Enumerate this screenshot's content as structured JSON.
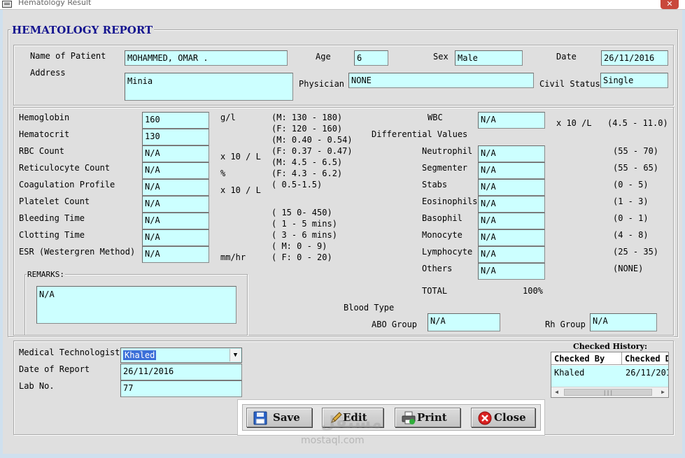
{
  "window": {
    "title": "Hematology Result"
  },
  "report_title": "HEMATOLOGY REPORT",
  "patient": {
    "name_label": "Name of Patient",
    "name": "MOHAMMED, OMAR  .",
    "age_label": "Age",
    "age": "6",
    "sex_label": "Sex",
    "sex": "Male",
    "date_label": "Date",
    "date": "26/11/2016",
    "address_label": "Address",
    "address": "Minia",
    "physician_label": "Physician",
    "physician": "NONE",
    "civil_status_label": "Civil Status",
    "civil_status": "Single"
  },
  "tests": [
    {
      "label": "Hemoglobin",
      "value": "160"
    },
    {
      "label": "Hematocrit",
      "value": "130"
    },
    {
      "label": "RBC Count",
      "value": "N/A"
    },
    {
      "label": "Reticulocyte Count",
      "value": "N/A"
    },
    {
      "label": "Coagulation Profile",
      "value": "N/A"
    },
    {
      "label": "Platelet Count",
      "value": "N/A"
    },
    {
      "label": "Bleeding Time",
      "value": "N/A"
    },
    {
      "label": "Clotting Time",
      "value": "N/A"
    },
    {
      "label": "ESR (Westergren Method)",
      "value": "N/A"
    }
  ],
  "units": {
    "hemoglobin": "g/l",
    "rbc": "x 10 / L",
    "retic": "%",
    "coag": "x 10 / L",
    "esr": "mm/hr"
  },
  "ranges": [
    "(M: 130 - 180)",
    "(F: 120 - 160)",
    "(M: 0.40 - 0.54)",
    "(F: 0.37 - 0.47)",
    "(M: 4.5 - 6.5)",
    "(F: 4.3 - 6.2)",
    "( 0.5-1.5)",
    "( 15 0- 450)",
    "( 1 - 5 mins)",
    "( 3 - 6 mins)",
    "( M: 0 - 9)",
    "( F: 0 - 20)"
  ],
  "wbc": {
    "label": "WBC",
    "value": "N/A",
    "unit": "x 10 /L",
    "range": "(4.5 - 11.0)"
  },
  "differential": {
    "title": "Differential Values",
    "items": [
      {
        "label": "Neutrophil",
        "value": "N/A",
        "range": "(55 - 70)"
      },
      {
        "label": "Segmenter",
        "value": "N/A",
        "range": "(55 - 65)"
      },
      {
        "label": "Stabs",
        "value": "N/A",
        "range": "(0 - 5)"
      },
      {
        "label": "Eosinophils",
        "value": "N/A",
        "range": "(1 - 3)"
      },
      {
        "label": "Basophil",
        "value": "N/A",
        "range": "(0 - 1)"
      },
      {
        "label": "Monocyte",
        "value": "N/A",
        "range": "(4 - 8)"
      },
      {
        "label": "Lymphocyte",
        "value": "N/A",
        "range": "(25 - 35)"
      },
      {
        "label": "Others",
        "value": "N/A",
        "range": "(NONE)"
      }
    ],
    "total_label": "TOTAL",
    "total_value": "100%"
  },
  "remarks": {
    "label": "REMARKS:",
    "value": "N/A"
  },
  "blood_type": {
    "label": "Blood Type",
    "abo_label": "ABO Group",
    "abo_value": "N/A",
    "rh_label": "Rh Group",
    "rh_value": "N/A"
  },
  "footer": {
    "medtech_label": "Medical Technologist",
    "medtech_value": "Khaled",
    "date_report_label": "Date of Report",
    "date_report_value": "26/11/2016",
    "lab_no_label": "Lab No.",
    "lab_no_value": "77"
  },
  "history": {
    "title": "Checked History:",
    "columns": [
      "Checked By",
      "Checked D"
    ],
    "rows": [
      [
        "Khaled",
        "26/11/201"
      ]
    ]
  },
  "buttons": {
    "save": "Save",
    "edit": "Edit",
    "print": "Print",
    "close": "Close"
  },
  "icons": {
    "save": "floppy-disk-icon",
    "edit": "pencil-icon",
    "print": "printer-icon",
    "close": "red-x-circle-icon"
  },
  "watermark": {
    "text": "mostaql.com",
    "text_ar": "مستقل"
  }
}
